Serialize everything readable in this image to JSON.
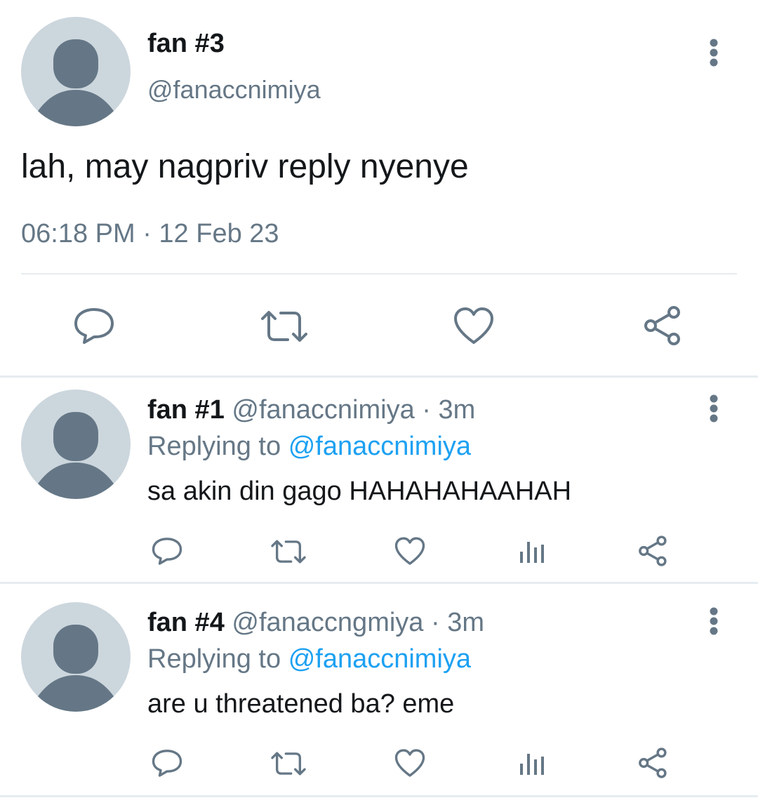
{
  "main_tweet": {
    "display_name": "fan #3",
    "handle": "@fanaccnimiya",
    "text": "lah, may nagpriv reply nyenye",
    "timestamp": "06:18 PM · 12 Feb 23",
    "actions": [
      "reply-icon",
      "retweet-icon",
      "like-icon",
      "share-icon"
    ]
  },
  "replies": [
    {
      "display_name": "fan #1",
      "handle": "@fanaccnimiya",
      "age": "· 3m",
      "replying_prefix": "Replying to",
      "replying_handle": "@fanaccnimiya",
      "text": "sa akin din gago HAHAHAHAAHAH",
      "actions": [
        "reply-icon",
        "retweet-icon",
        "like-icon",
        "analytics-icon",
        "share-icon"
      ]
    },
    {
      "display_name": "fan #4",
      "handle": "@fanaccngmiya",
      "age": "· 3m",
      "replying_prefix": "Replying to",
      "replying_handle": "@fanaccnimiya",
      "text": "are u threatened ba? eme",
      "actions": [
        "reply-icon",
        "retweet-icon",
        "like-icon",
        "analytics-icon",
        "share-icon"
      ]
    }
  ],
  "colors": {
    "text": "#14171a",
    "secondary": "#657786",
    "link": "#1da1f2",
    "avatar_bg": "#ccd6dd",
    "avatar_fg": "#657786",
    "divider": "#e6ecf0"
  }
}
